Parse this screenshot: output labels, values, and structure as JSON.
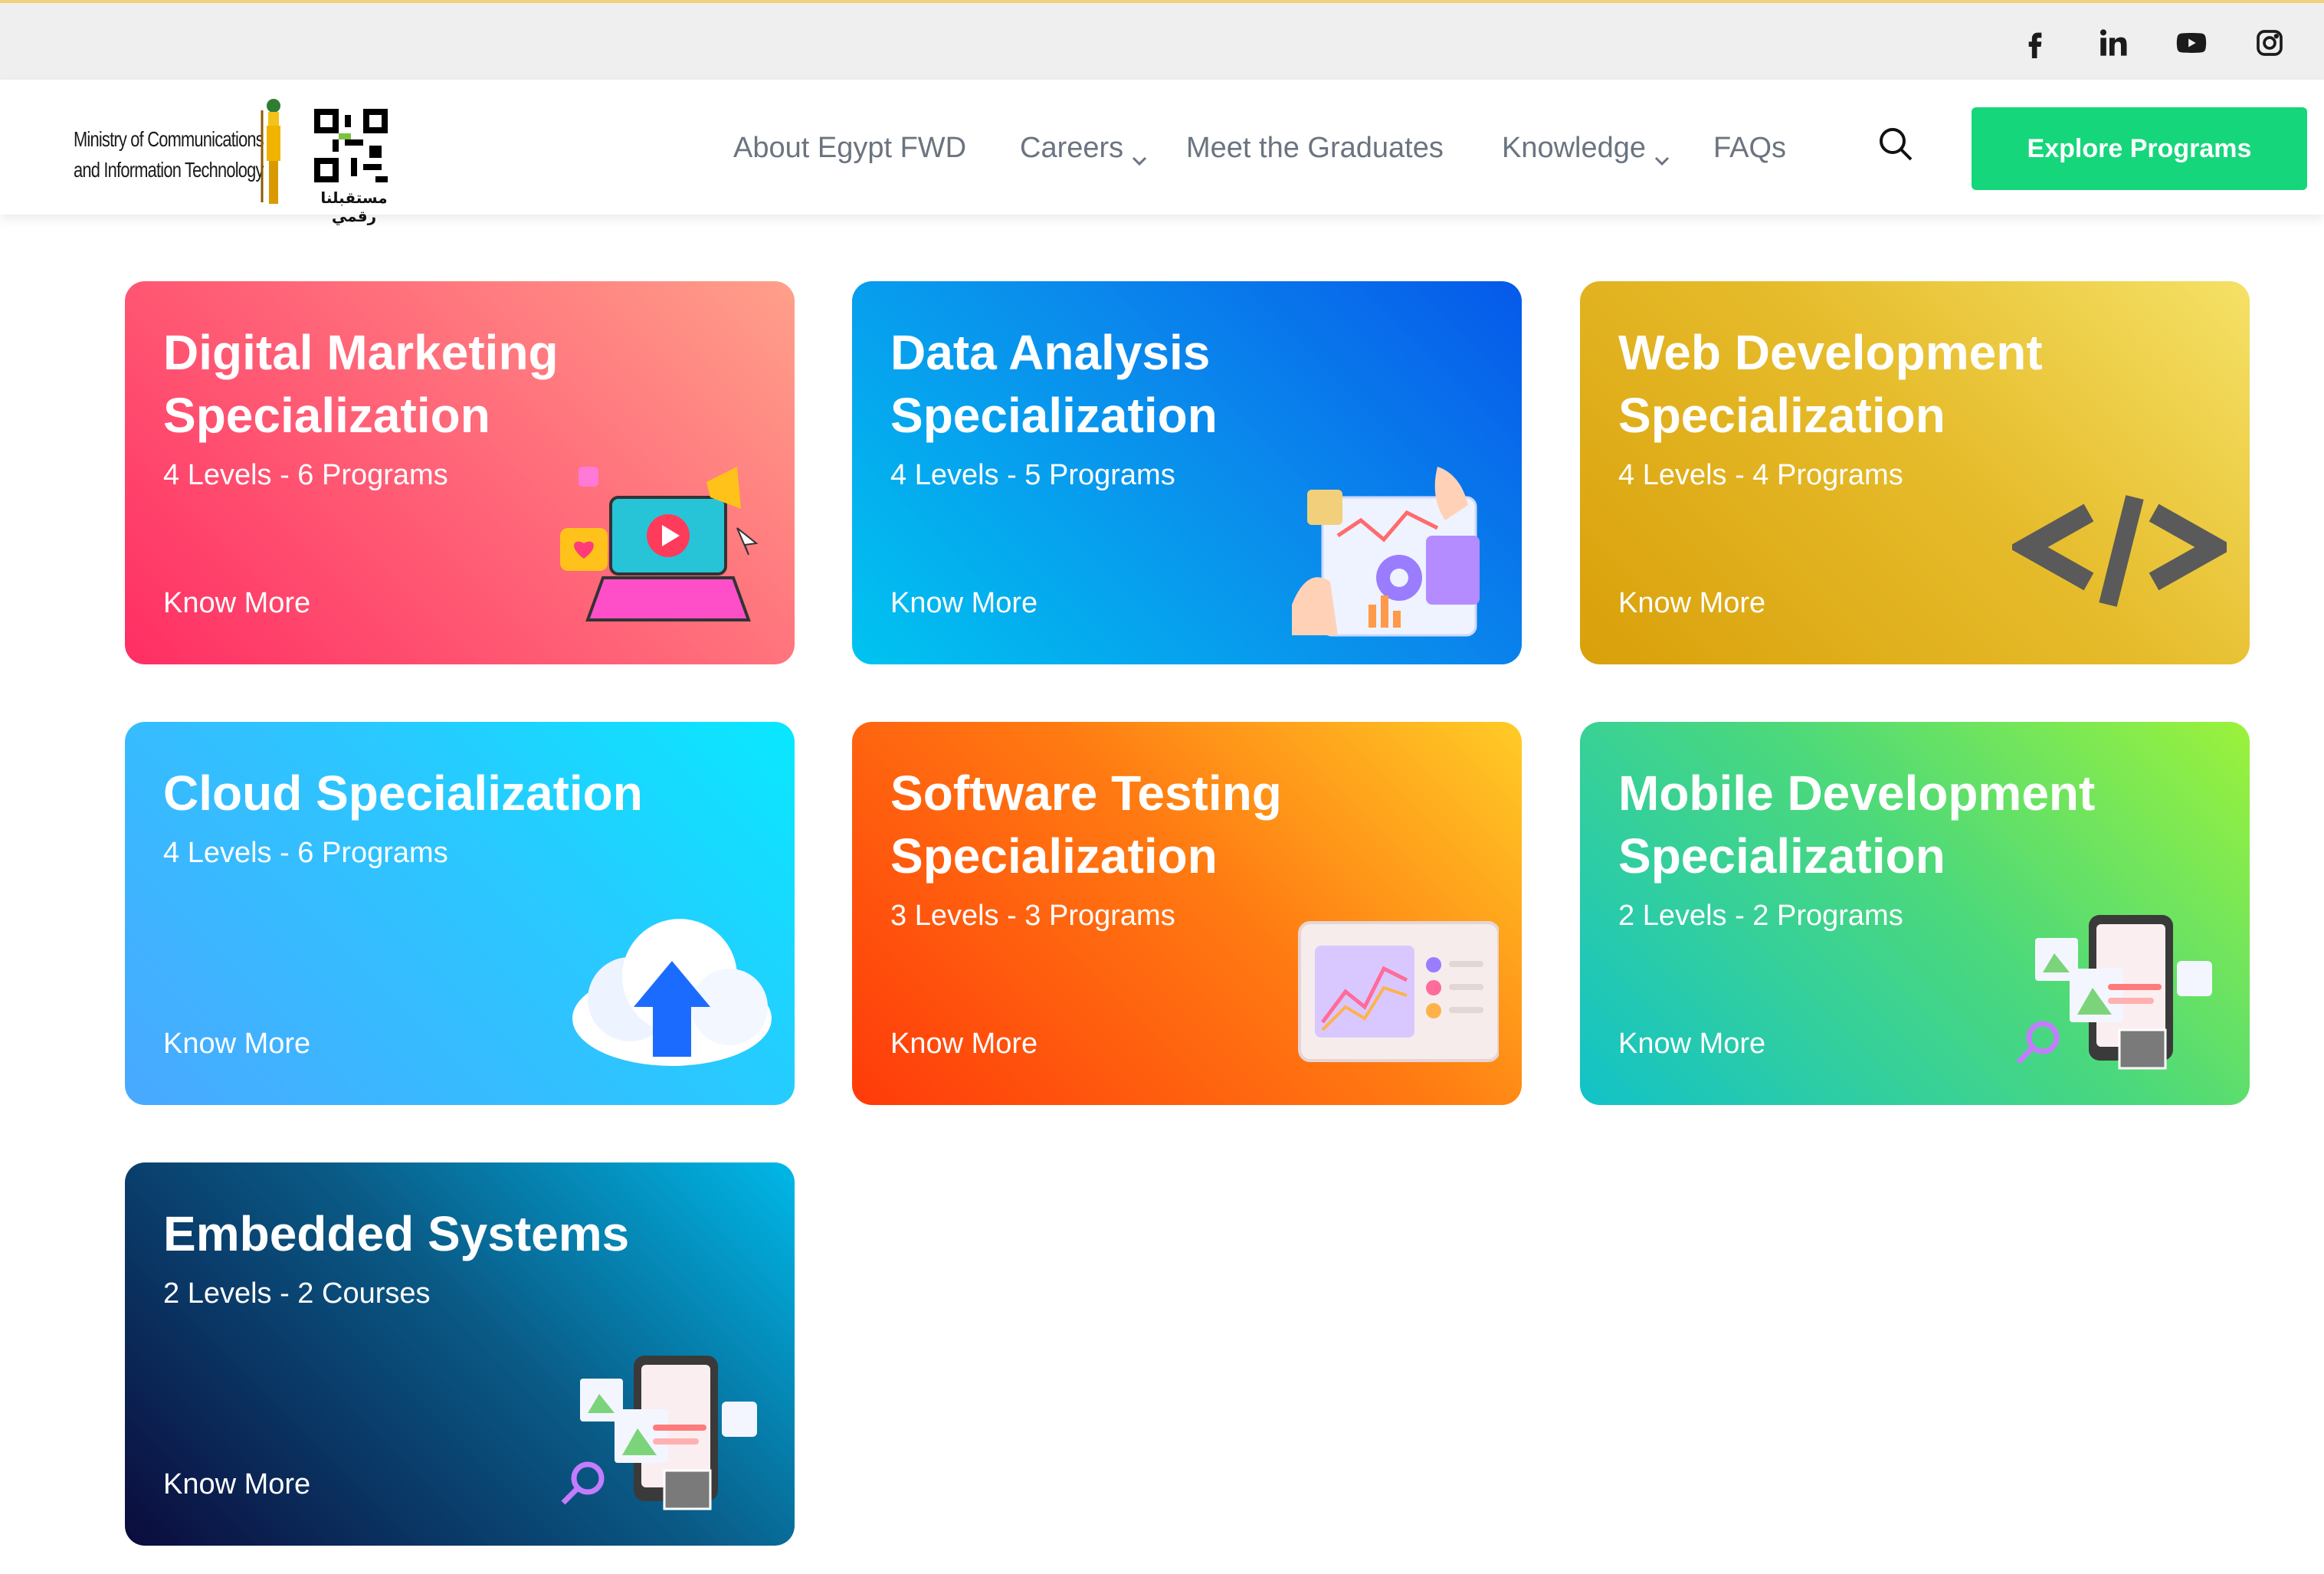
{
  "social": {
    "icons": [
      "facebook-icon",
      "linkedin-icon",
      "youtube-icon",
      "instagram-icon"
    ]
  },
  "header": {
    "logo": {
      "line1": "Ministry of Communications",
      "line2": "and Information Technology",
      "arabic": "مستقبلنا رقمي"
    },
    "nav": {
      "about": "About Egypt FWD",
      "careers": "Careers",
      "graduates": "Meet the Graduates",
      "knowledge": "Knowledge",
      "faqs": "FAQs"
    },
    "explore_label": "Explore Programs"
  },
  "cards": [
    {
      "title": "Digital Marketing Specialization",
      "meta": "4 Levels - 6 Programs",
      "more": "Know More"
    },
    {
      "title": "Data Analysis Specialization",
      "meta": "4 Levels - 5 Programs",
      "more": "Know More"
    },
    {
      "title": "Web Development Specialization",
      "meta": "4 Levels - 4 Programs",
      "more": "Know More"
    },
    {
      "title": "Cloud Specialization",
      "meta": "4 Levels - 6 Programs",
      "more": "Know More"
    },
    {
      "title": "Software Testing Specialization",
      "meta": "3 Levels - 3 Programs",
      "more": "Know More"
    },
    {
      "title": "Mobile Development Specialization",
      "meta": "2 Levels - 2 Programs",
      "more": "Know More"
    },
    {
      "title": "Embedded Systems",
      "meta": "2 Levels - 2 Courses",
      "more": "Know More"
    }
  ],
  "colors": {
    "accent_button": "#16d67c",
    "nav_text": "#6b7480"
  }
}
